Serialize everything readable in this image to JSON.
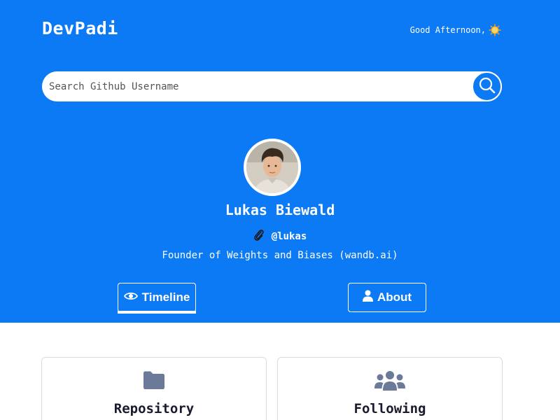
{
  "header": {
    "brand": "DevPadi",
    "greeting": "Good Afternoon,",
    "greeting_icon": "sun-icon"
  },
  "search": {
    "placeholder": "Search Github Username",
    "value": "",
    "button_icon": "search-icon"
  },
  "profile": {
    "name": "Lukas Biewald",
    "handle": "@lukas",
    "handle_icon": "paperclip-icon",
    "bio": "Founder of Weights and Biases (wandb.ai)"
  },
  "tabs": [
    {
      "label": "Timeline",
      "icon": "eye-icon",
      "active": true
    },
    {
      "label": "About",
      "icon": "user-icon",
      "active": false
    }
  ],
  "cards": [
    {
      "title": "Repository",
      "icon": "folder-icon"
    },
    {
      "title": "Following",
      "icon": "users-icon"
    }
  ],
  "colors": {
    "primary": "#0c7af5",
    "card_icon": "#6b7a99",
    "card_border": "#dcdcdc"
  }
}
